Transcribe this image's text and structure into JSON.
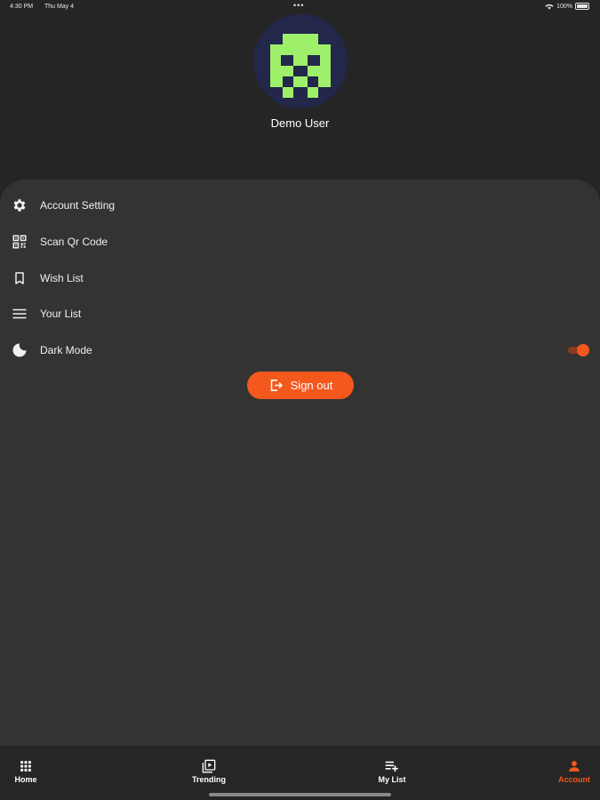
{
  "status_bar": {
    "time": "4:30 PM",
    "date": "Thu May 4",
    "dots": "•••",
    "battery": "100%"
  },
  "profile": {
    "name": "Demo User",
    "avatar_bg": "#23274a",
    "avatar_fg": "#9ef06a"
  },
  "menu": {
    "items": [
      {
        "label": "Account Setting",
        "icon": "gear-icon"
      },
      {
        "label": "Scan Qr Code",
        "icon": "qr-code-icon"
      },
      {
        "label": "Wish List",
        "icon": "bookmark-icon"
      },
      {
        "label": "Your List",
        "icon": "list-icon"
      },
      {
        "label": "Dark Mode",
        "icon": "moon-icon"
      }
    ],
    "dark_mode_enabled": true
  },
  "sign_out": {
    "label": "Sign out",
    "icon": "logout-icon"
  },
  "tabs": [
    {
      "label": "Home",
      "icon": "grid-icon",
      "active": false
    },
    {
      "label": "Trending",
      "icon": "video-library-icon",
      "active": false
    },
    {
      "label": "My List",
      "icon": "playlist-add-icon",
      "active": false
    },
    {
      "label": "Account",
      "icon": "person-icon",
      "active": true
    }
  ],
  "colors": {
    "accent": "#f4581c",
    "background": "#252525",
    "panel": "#333333"
  }
}
